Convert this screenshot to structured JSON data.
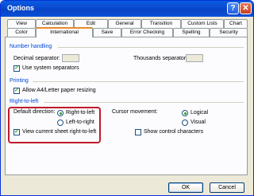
{
  "window": {
    "title": "Options",
    "help_glyph": "?",
    "close_glyph": "✕"
  },
  "tabs_row1": [
    "View",
    "Calculation",
    "Edit",
    "General",
    "Transition",
    "Custom Lists",
    "Chart"
  ],
  "tabs_row2": [
    "Color",
    "International",
    "Save",
    "Error Checking",
    "Spelling",
    "Security"
  ],
  "active_tab": "International",
  "number_handling": {
    "heading": "Number handling",
    "decimal_label": "Decimal separator:",
    "decimal_value": "",
    "thousands_label": "Thousands separator:",
    "thousands_value": "",
    "use_system_label": "Use system separators",
    "use_system_checked": true
  },
  "printing": {
    "heading": "Printing",
    "allow_a4_label": "Allow A4/Letter paper resizing",
    "allow_a4_checked": true
  },
  "rtl": {
    "heading": "Right-to-left",
    "default_direction_label": "Default direction:",
    "right_to_left_label": "Right-to-left",
    "left_to_right_label": "Left-to-right",
    "selected_direction": "Right-to-left",
    "view_current_label": "View current sheet right-to-left",
    "view_current_checked": true,
    "cursor_movement_label": "Cursor movement:",
    "logical_label": "Logical",
    "visual_label": "Visual",
    "selected_cursor": "Logical",
    "show_control_label": "Show control characters",
    "show_control_checked": false
  },
  "buttons": {
    "ok": "OK",
    "cancel": "Cancel"
  },
  "colors": {
    "title_bar": "#0a50d8",
    "section_heading": "#0046d5",
    "highlight": "#c0192a"
  }
}
